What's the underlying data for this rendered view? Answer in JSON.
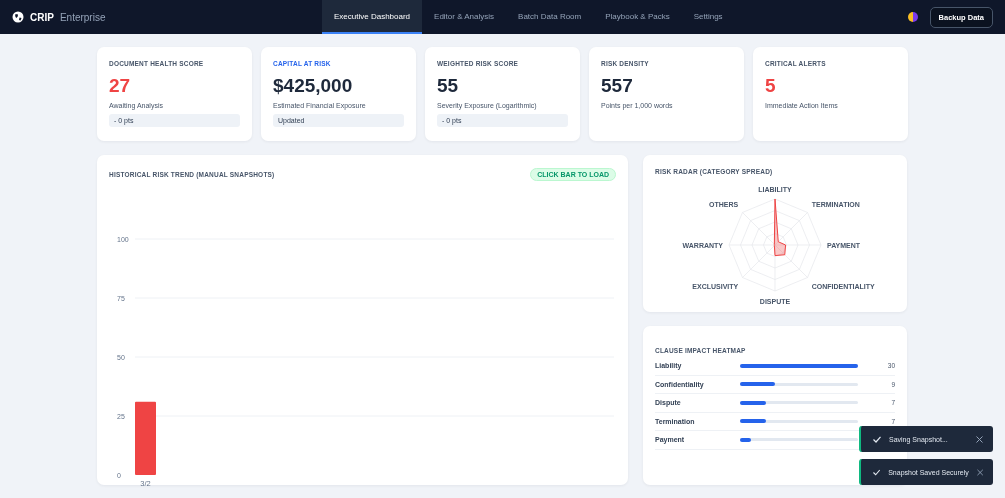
{
  "header": {
    "brand": "CRIP",
    "edition": "Enterprise",
    "tabs": [
      {
        "label": "Executive Dashboard",
        "selected": true
      },
      {
        "label": "Editor & Analysis",
        "selected": false
      },
      {
        "label": "Batch Data Room",
        "selected": false
      },
      {
        "label": "Playbook & Packs",
        "selected": false
      },
      {
        "label": "Settings",
        "selected": false
      }
    ],
    "backup_button": "Backup Data"
  },
  "metrics": [
    {
      "title": "DOCUMENT HEALTH SCORE",
      "title_accent": false,
      "value": "27",
      "alert": true,
      "caption": "Awaiting Analysis",
      "badge": "- 0 pts"
    },
    {
      "title": "CAPITAL AT RISK",
      "title_accent": true,
      "value": "$425,000",
      "alert": false,
      "caption": "Estimated Financial Exposure",
      "badge": "Updated"
    },
    {
      "title": "WEIGHTED RISK SCORE",
      "title_accent": false,
      "value": "55",
      "alert": false,
      "caption": "Severity Exposure (Logarithmic)",
      "badge": "- 0 pts"
    },
    {
      "title": "RISK DENSITY",
      "title_accent": false,
      "value": "557",
      "alert": false,
      "caption": "Points per 1,000 words"
    },
    {
      "title": "CRITICAL ALERTS",
      "title_accent": false,
      "value": "5",
      "alert": true,
      "caption": "Immediate Action Items"
    }
  ],
  "trend": {
    "title": "HISTORICAL RISK TREND (MANUAL SNAPSHOTS)",
    "hint_badge": "CLICK BAR TO LOAD",
    "chart_data": {
      "type": "bar",
      "categories": [
        "3/2"
      ],
      "series": [
        {
          "color": "#ef4444",
          "values": [
            31
          ]
        }
      ],
      "ylim": [
        0,
        100
      ],
      "yticks": [
        0,
        25,
        50,
        75,
        100
      ],
      "grid": true
    }
  },
  "radar": {
    "title": "RISK RADAR (CATEGORY SPREAD)",
    "axes": [
      "LIABILITY",
      "OTHERS",
      "TERMINATION",
      "WARRANTY",
      "PAYMENT",
      "EXCLUSIVITY",
      "CONFIDENTIALITY",
      "DISPUTE"
    ]
  },
  "heatmap": {
    "title": "CLAUSE IMPACT HEATMAP",
    "rows": [
      {
        "label": "Liability",
        "level": 1.0,
        "value": "30"
      },
      {
        "label": "Confidentiality",
        "level": 0.3,
        "value": "9"
      },
      {
        "label": "Dispute",
        "level": 0.22,
        "value": "7"
      },
      {
        "label": "Termination",
        "level": 0.22,
        "value": "7"
      },
      {
        "label": "Payment",
        "level": 0.09
      }
    ]
  },
  "toasts": [
    {
      "message": "Saving Snapshot..."
    },
    {
      "message": "Snapshot Saved Securely"
    }
  ]
}
